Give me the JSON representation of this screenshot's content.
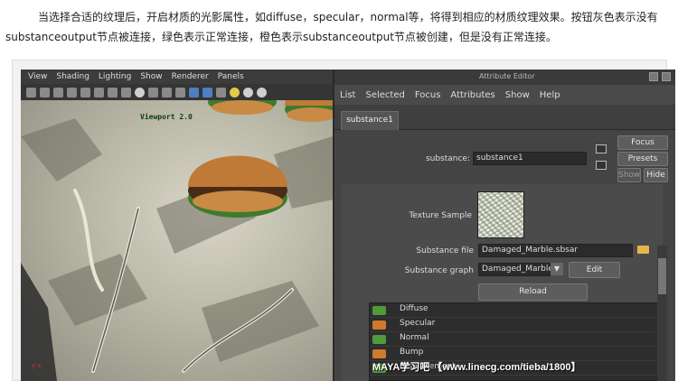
{
  "article": {
    "text": "当选择合适的纹理后，开启材质的光影属性，如diffuse，specular，normal等，将得到相应的材质纹理效果。按钮灰色表示没有substanceoutput节点被连接，绿色表示正常连接，橙色表示substanceoutput节点被创建，但是没有正常连接。"
  },
  "viewport": {
    "menu": [
      "View",
      "Shading",
      "Lighting",
      "Show",
      "Renderer",
      "Panels"
    ],
    "label": "Viewport 2.0"
  },
  "attribute_editor": {
    "title": "Attribute Editor",
    "menu": [
      "List",
      "Selected",
      "Focus",
      "Attributes",
      "Show",
      "Help"
    ],
    "tab": "substance1",
    "substance_label": "substance:",
    "substance_value": "substance1",
    "focus_button": "Focus",
    "presets_button": "Presets",
    "show_button": "Show",
    "hide_button": "Hide",
    "texture_sample_label": "Texture Sample",
    "substance_file_label": "Substance file",
    "substance_file_value": "Damaged_Marble.sbsar",
    "substance_graph_label": "Substance graph",
    "substance_graph_value": "Damaged_Marble",
    "edit_button": "Edit",
    "reload_button": "Reload",
    "outputs": [
      {
        "label": "Diffuse",
        "state": "green"
      },
      {
        "label": "Specular",
        "state": "orange"
      },
      {
        "label": "Normal",
        "state": "green"
      },
      {
        "label": "Bump",
        "state": "orange"
      },
      {
        "label": "Displacement",
        "state": "green"
      }
    ]
  },
  "watermark": "MAYA学习吧 【www.linecg.com/tieba/1800】",
  "colors": {
    "toggle_green": "#4f9a3c",
    "toggle_orange": "#d0782e"
  }
}
